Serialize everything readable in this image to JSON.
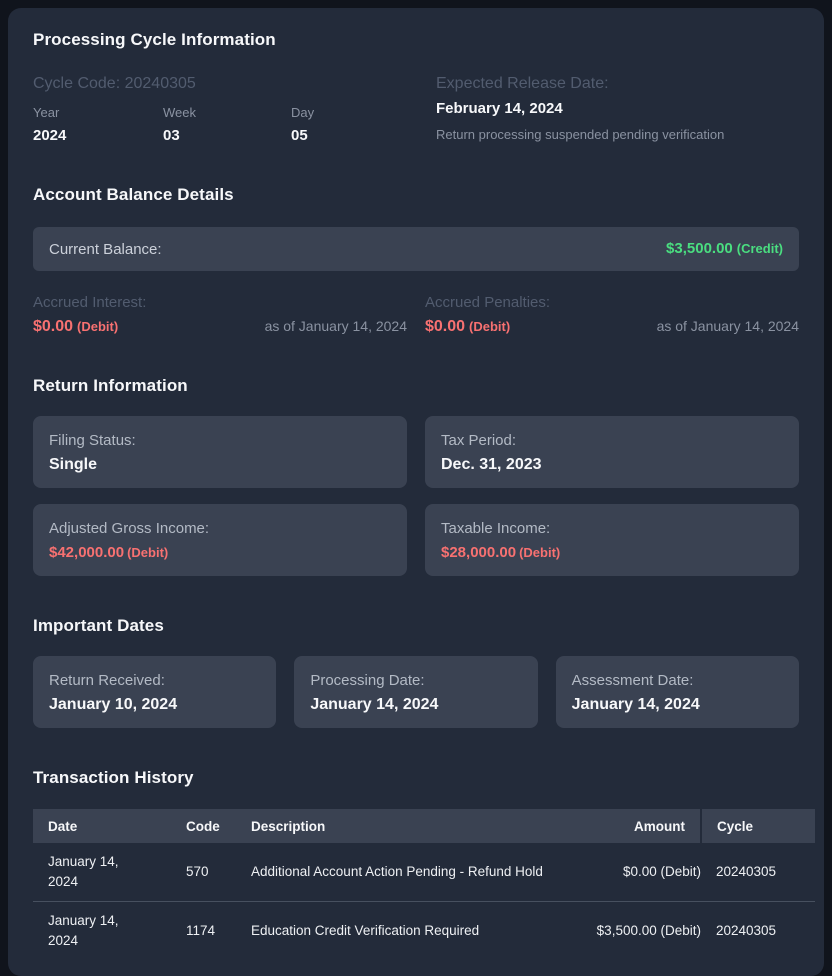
{
  "theme": {
    "outer_bg": "#10141c",
    "card_bg": "#232b3a",
    "box_bg": "#3a4252",
    "accent_green": "#4ade80",
    "accent_red": "#f87171"
  },
  "processing_cycle": {
    "title": "Processing Cycle Information",
    "cycle_code_label": "Cycle Code: 20240305",
    "fields": [
      {
        "label": "Year",
        "value": "2024"
      },
      {
        "label": "Week",
        "value": "03"
      },
      {
        "label": "Day",
        "value": "05"
      }
    ],
    "expected_release_label": "Expected Release Date:",
    "expected_release_date": "February 14, 2024",
    "release_note": "Return processing suspended pending verification"
  },
  "account_balance": {
    "title": "Account Balance Details",
    "current_balance_label": "Current Balance:",
    "current_balance_amount": "$3,500.00",
    "current_balance_suffix": "(Credit)",
    "accrued": [
      {
        "label": "Accrued Interest:",
        "amount": "$0.00",
        "suffix": "(Debit)",
        "as_of": "as of January 14, 2024"
      },
      {
        "label": "Accrued Penalties:",
        "amount": "$0.00",
        "suffix": "(Debit)",
        "as_of": "as of January 14, 2024"
      }
    ]
  },
  "return_information": {
    "title": "Return Information",
    "cards": [
      {
        "label": "Filing Status:",
        "value": "Single"
      },
      {
        "label": "Tax Period:",
        "value": "Dec. 31, 2023"
      },
      {
        "label": "Adjusted Gross Income:",
        "value": "$42,000.00",
        "suffix": "(Debit)"
      },
      {
        "label": "Taxable Income:",
        "value": "$28,000.00",
        "suffix": "(Debit)"
      }
    ]
  },
  "important_dates": {
    "title": "Important Dates",
    "cards": [
      {
        "label": "Return Received:",
        "value": "January 10, 2024"
      },
      {
        "label": "Processing Date:",
        "value": "January 14, 2024"
      },
      {
        "label": "Assessment Date:",
        "value": "January 14, 2024"
      }
    ]
  },
  "transaction_history": {
    "title": "Transaction History",
    "columns": [
      "Date",
      "Code",
      "Description",
      "Amount",
      "Cycle"
    ],
    "rows": [
      {
        "date": "January 14, 2024",
        "code": "570",
        "description": "Additional Account Action Pending - Refund Hold",
        "amount": "$0.00 (Debit)",
        "cycle": "20240305"
      },
      {
        "date": "January 14, 2024",
        "code": "1174",
        "description": "Education Credit Verification Required",
        "amount": "$3,500.00 (Debit)",
        "cycle": "20240305"
      }
    ]
  }
}
